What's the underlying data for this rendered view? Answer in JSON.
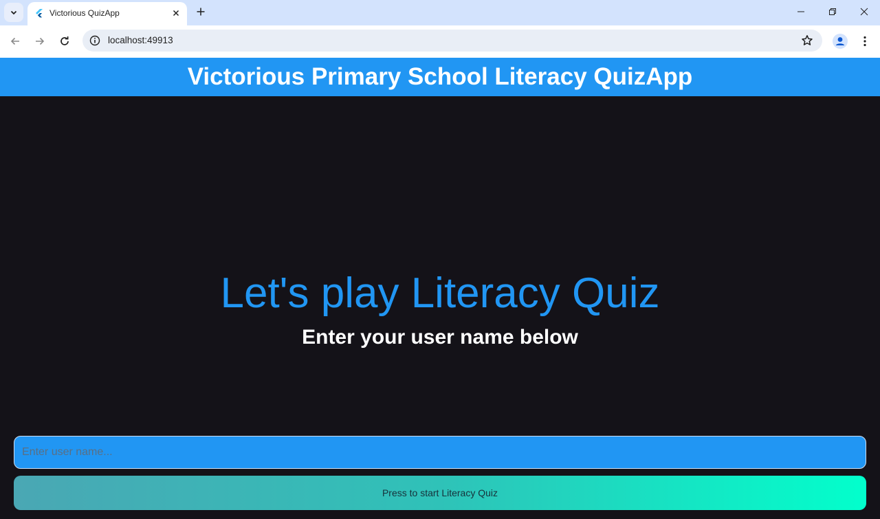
{
  "browser": {
    "tab_title": "Victorious QuizApp",
    "url": "localhost:49913",
    "icons": {
      "tab_search": "chevron-down-icon",
      "favicon": "flutter-icon",
      "tab_close": "close-icon",
      "new_tab": "plus-icon",
      "back": "arrow-left-icon",
      "forward": "arrow-right-icon",
      "reload": "reload-icon",
      "site_info": "info-icon",
      "bookmark": "star-icon",
      "profile": "profile-icon",
      "menu": "kebab-menu-icon",
      "minimize": "minimize-icon",
      "restore": "restore-icon",
      "close_window": "close-icon"
    }
  },
  "app": {
    "appbar_title": "Victorious Primary School Literacy QuizApp",
    "headline": "Let's play Literacy Quiz",
    "subheadline": "Enter your user name below",
    "username_input": {
      "placeholder": "Enter user name...",
      "value": ""
    },
    "start_button_label": "Press to start Literacy Quiz",
    "colors": {
      "primary": "#2196f3",
      "background": "#141218",
      "gradient_start": "#4aa7b4",
      "gradient_end": "#02ffcc"
    }
  }
}
